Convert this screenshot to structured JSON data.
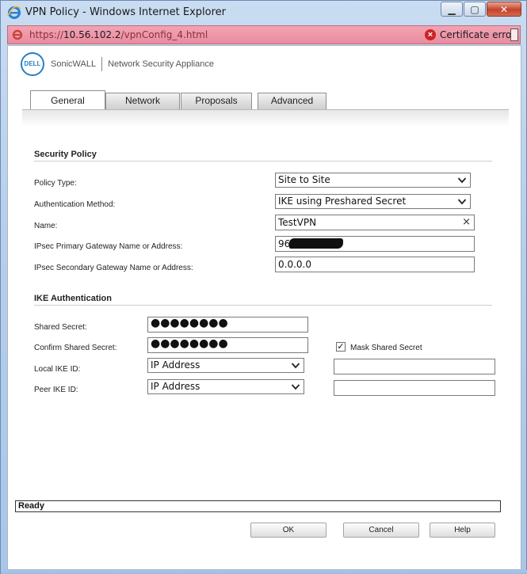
{
  "window": {
    "title": "VPN Policy - Windows Internet Explorer",
    "minimize_glyph": "▁",
    "maximize_glyph": "▢",
    "close_glyph": "✕"
  },
  "address": {
    "scheme": "https://",
    "host": "10.56.102.2",
    "path": "/vpnConfig_4.html",
    "cert_error": "Certificate error"
  },
  "brand": {
    "logo_text": "DELL",
    "product": "SonicWALL",
    "subtitle": "Network Security Appliance"
  },
  "tabs": [
    {
      "label": "General",
      "active": true
    },
    {
      "label": "Network",
      "active": false
    },
    {
      "label": "Proposals",
      "active": false
    },
    {
      "label": "Advanced",
      "active": false
    }
  ],
  "security_policy": {
    "title": "Security Policy",
    "policy_type": {
      "label": "Policy Type:",
      "value": "Site to Site"
    },
    "auth_method": {
      "label": "Authentication Method:",
      "value": "IKE using Preshared Secret"
    },
    "name": {
      "label": "Name:",
      "value": "TestVPN"
    },
    "primary_gw": {
      "label": "IPsec Primary Gateway Name or Address:",
      "value": "96"
    },
    "secondary_gw": {
      "label": "IPsec Secondary Gateway Name or Address:",
      "value": "0.0.0.0"
    }
  },
  "ike_auth": {
    "title": "IKE Authentication",
    "shared_secret": {
      "label": "Shared Secret:",
      "value": "●●●●●●●●"
    },
    "confirm_secret": {
      "label": "Confirm Shared Secret:",
      "value": "●●●●●●●●"
    },
    "mask": {
      "label": "Mask Shared Secret",
      "checked": true,
      "check_glyph": "✓"
    },
    "local_ike_id": {
      "label": "Local IKE ID:",
      "value": "IP Address",
      "text": ""
    },
    "peer_ike_id": {
      "label": "Peer IKE ID:",
      "value": "IP Address",
      "text": ""
    }
  },
  "status": {
    "text": "Ready"
  },
  "buttons": {
    "ok": "OK",
    "cancel": "Cancel",
    "help": "Help"
  },
  "colors": {
    "cert_error_bar": "#e98ca0",
    "logo_blue": "#2a7fc1",
    "title_frame": "#b6cfeb"
  }
}
